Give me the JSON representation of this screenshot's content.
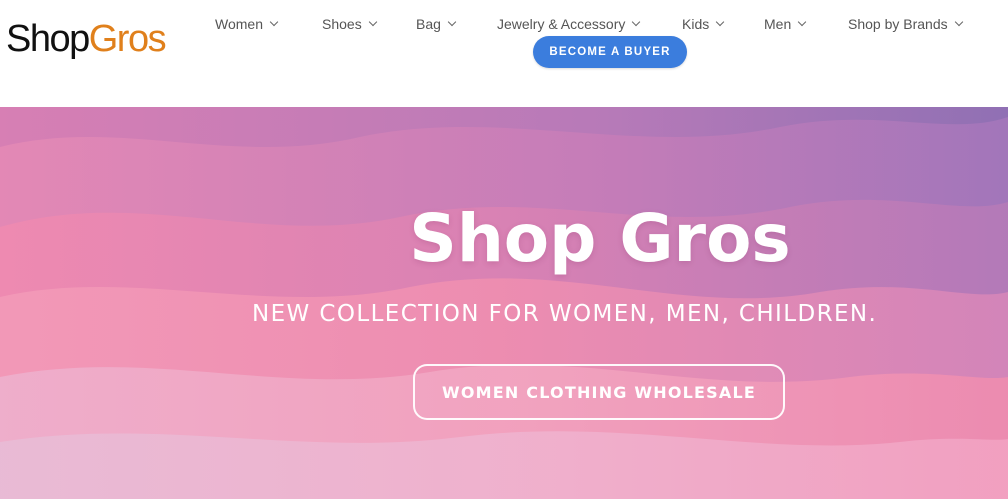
{
  "logo": {
    "part1": "Shop",
    "part2": "Gros",
    "color_part1": "#111111",
    "color_part2": "#e0801c"
  },
  "nav": {
    "items": [
      {
        "label": "Women"
      },
      {
        "label": "Shoes"
      },
      {
        "label": "Bag"
      },
      {
        "label": "Jewelry & Accessory"
      },
      {
        "label": "Kids"
      },
      {
        "label": "Men"
      },
      {
        "label": "Shop by Brands"
      }
    ]
  },
  "buyer_button": {
    "label": "BECOME A BUYER",
    "color": "#3b7ddd"
  },
  "hero": {
    "title": "Shop Gros",
    "subtitle": "NEW COLLECTION FOR WOMEN, MEN, CHILDREN.",
    "cta_label": "WOMEN CLOTHING WHOLESALE"
  }
}
